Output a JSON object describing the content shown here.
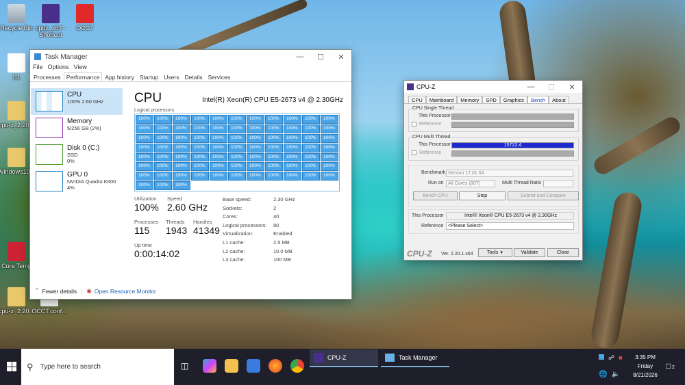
{
  "desktop": {
    "icons": [
      {
        "label": "Recycle Bin",
        "icon": "recycle-bin-icon"
      },
      {
        "label": "cpuz_x64 - Shortcut",
        "icon": "cpuz-icon"
      },
      {
        "label": "OCCT",
        "icon": "occt-icon"
      },
      {
        "label": "S1",
        "icon": "document-icon"
      },
      {
        "label": "cpu-z_2.20...",
        "icon": "folder-icon"
      },
      {
        "label": "Windows10...",
        "icon": "folder-icon"
      },
      {
        "label": "Core Temp",
        "icon": "core-temp-icon"
      },
      {
        "label": "cpu-z_2.20...",
        "icon": "folder-icon"
      },
      {
        "label": "OCCT.conf...",
        "icon": "file-icon"
      }
    ]
  },
  "taskmanager": {
    "title": "Task Manager",
    "menu": [
      "File",
      "Options",
      "View"
    ],
    "tabs": [
      "Processes",
      "Performance",
      "App history",
      "Startup",
      "Users",
      "Details",
      "Services"
    ],
    "resources": [
      {
        "name": "CPU",
        "sub1": "100%  2.60 GHz",
        "sub2": "",
        "color": "#1f7fc4"
      },
      {
        "name": "Memory",
        "sub1": "5/256 GB (2%)",
        "sub2": "",
        "color": "#8b2fae"
      },
      {
        "name": "Disk 0 (C:)",
        "sub1": "SSD",
        "sub2": "0%",
        "color": "#4c9a2a"
      },
      {
        "name": "GPU 0",
        "sub1": "NVIDIA Quadro K600",
        "sub2": "4%",
        "color": "#1f7fc4"
      }
    ],
    "heading": "CPU",
    "model": "Intel(R) Xeon(R) CPU E5-2673 v4 @ 2.30GHz",
    "logical_label": "Logical processors",
    "core_value": "100%",
    "core_count": 80,
    "stats": {
      "utilization_label": "Utilization",
      "utilization": "100%",
      "speed_label": "Speed",
      "speed": "2.60 GHz",
      "processes_label": "Processes",
      "processes": "115",
      "threads_label": "Threads",
      "threads": "1943",
      "handles_label": "Handles",
      "handles": "41349",
      "uptime_label": "Up time",
      "uptime": "0:00:14:02"
    },
    "specs": [
      {
        "k": "Base speed:",
        "v": "2.30 GHz"
      },
      {
        "k": "Sockets:",
        "v": "2"
      },
      {
        "k": "Cores:",
        "v": "40"
      },
      {
        "k": "Logical processors:",
        "v": "80"
      },
      {
        "k": "Virtualization:",
        "v": "Enabled"
      },
      {
        "k": "L1 cache:",
        "v": "2.5 MB"
      },
      {
        "k": "L2 cache:",
        "v": "10.0 MB"
      },
      {
        "k": "L3 cache:",
        "v": "100 MB"
      }
    ],
    "fewer": "Fewer details",
    "orm": "Open Resource Monitor"
  },
  "cpuz": {
    "title": "CPU-Z",
    "tabs": [
      "CPU",
      "Mainboard",
      "Memory",
      "SPD",
      "Graphics",
      "Bench",
      "About"
    ],
    "single_title": "CPU Single Thread",
    "multi_title": "CPU Multi Thread",
    "this_processor": "This Processor",
    "reference": "Reference",
    "multi_score": "15722.4",
    "benchmark_label": "Benchmark",
    "benchmark_value": "Version 17.01.64",
    "runon_label": "Run on",
    "runon_value": "All Cores (80T)",
    "mtr_label": "Multi Thread Ratio",
    "bench_cpu": "Bench CPU",
    "stop": "Stop",
    "submit": "Submit and Compare",
    "proc_label": "This Processor",
    "proc_value": "Intel® Xeon® CPU E5-2673 v4 @ 2.30GHz",
    "ref_label": "Reference",
    "ref_value": "<Please Select>",
    "logo": "CPU-Z",
    "version": "Ver. 2.20.1.x64",
    "tools": "Tools",
    "validate": "Validate",
    "close": "Close"
  },
  "taskbar": {
    "search": "Type here to search",
    "apps": [
      {
        "label": "CPU-Z"
      },
      {
        "label": "Task Manager"
      }
    ],
    "time": "3:35 PM",
    "day": "Friday",
    "date": "8/21/2026",
    "notif": "2"
  }
}
